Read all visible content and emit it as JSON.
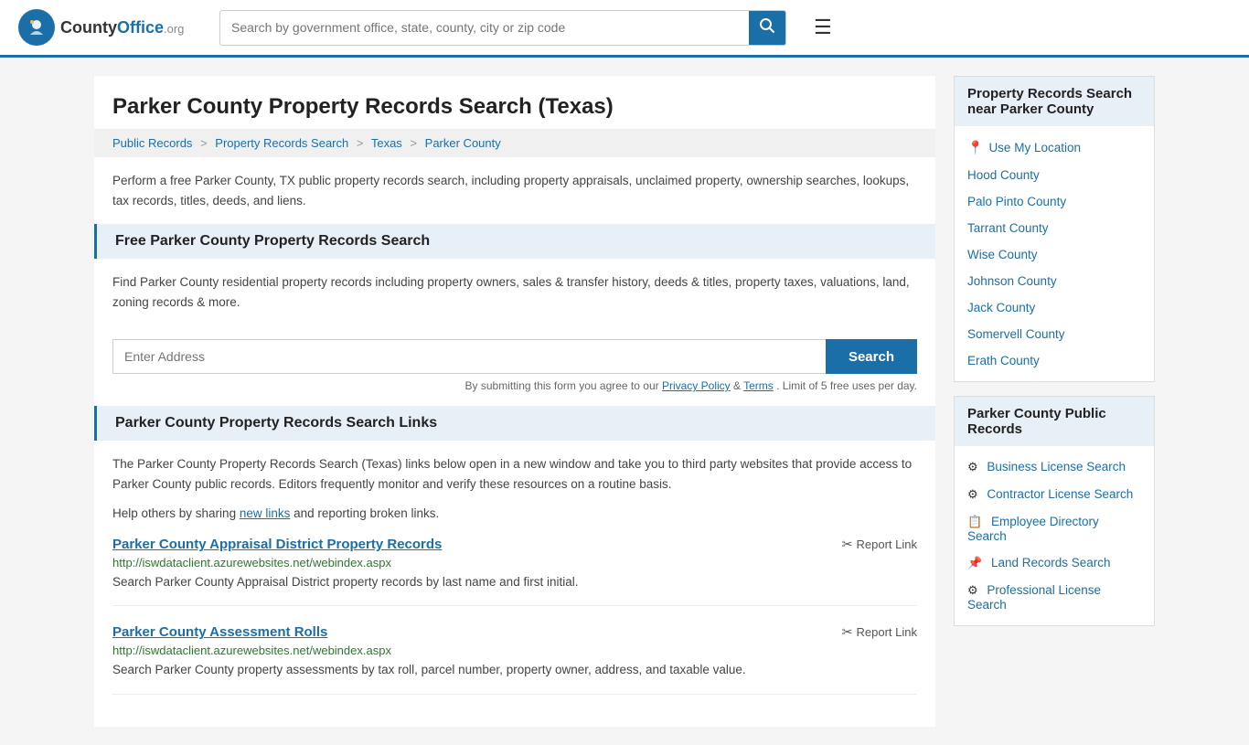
{
  "header": {
    "logo_text": "County",
    "logo_org": "Office",
    "logo_tld": ".org",
    "search_placeholder": "Search by government office, state, county, city or zip code"
  },
  "page": {
    "title": "Parker County Property Records Search (Texas)",
    "breadcrumb": [
      {
        "label": "Public Records",
        "href": "#"
      },
      {
        "label": "Property Records Search",
        "href": "#"
      },
      {
        "label": "Texas",
        "href": "#"
      },
      {
        "label": "Parker County",
        "href": "#"
      }
    ],
    "description": "Perform a free Parker County, TX public property records search, including property appraisals, unclaimed property, ownership searches, lookups, tax records, titles, deeds, and liens.",
    "free_search_title": "Free Parker County Property Records Search",
    "free_search_desc": "Find Parker County residential property records including property owners, sales & transfer history, deeds & titles, property taxes, valuations, land, zoning records & more.",
    "address_placeholder": "Enter Address",
    "search_button": "Search",
    "form_note": "By submitting this form you agree to our",
    "privacy_policy": "Privacy Policy",
    "terms": "Terms",
    "limit_note": ". Limit of 5 free uses per day.",
    "links_title": "Parker County Property Records Search Links",
    "links_desc": "The Parker County Property Records Search (Texas) links below open in a new window and take you to third party websites that provide access to Parker County public records. Editors frequently monitor and verify these resources on a routine basis.",
    "new_links_text": "Help others by sharing",
    "new_links_link": "new links",
    "new_links_suffix": " and reporting broken links.",
    "records": [
      {
        "title": "Parker County Appraisal District Property Records",
        "url": "http://iswdataclient.azurewebsites.net/webindex.aspx",
        "description": "Search Parker County Appraisal District property records by last name and first initial.",
        "report_label": "Report Link"
      },
      {
        "title": "Parker County Assessment Rolls",
        "url": "http://iswdataclient.azurewebsites.net/webindex.aspx",
        "description": "Search Parker County property assessments by tax roll, parcel number, property owner, address, and taxable value.",
        "report_label": "Report Link"
      }
    ]
  },
  "sidebar": {
    "nearby_title": "Property Records Search near Parker County",
    "use_my_location": "Use My Location",
    "nearby_counties": [
      {
        "name": "Hood County",
        "href": "#"
      },
      {
        "name": "Palo Pinto County",
        "href": "#"
      },
      {
        "name": "Tarrant County",
        "href": "#"
      },
      {
        "name": "Wise County",
        "href": "#"
      },
      {
        "name": "Johnson County",
        "href": "#"
      },
      {
        "name": "Jack County",
        "href": "#"
      },
      {
        "name": "Somervell County",
        "href": "#"
      },
      {
        "name": "Erath County",
        "href": "#"
      }
    ],
    "public_records_title": "Parker County Public Records",
    "public_records_links": [
      {
        "label": "Business License Search",
        "icon": "⚙"
      },
      {
        "label": "Contractor License Search",
        "icon": "⚙"
      },
      {
        "label": "Employee Directory Search",
        "icon": "📋"
      },
      {
        "label": "Land Records Search",
        "icon": "📌"
      },
      {
        "label": "Professional License Search",
        "icon": "⚙"
      }
    ]
  }
}
